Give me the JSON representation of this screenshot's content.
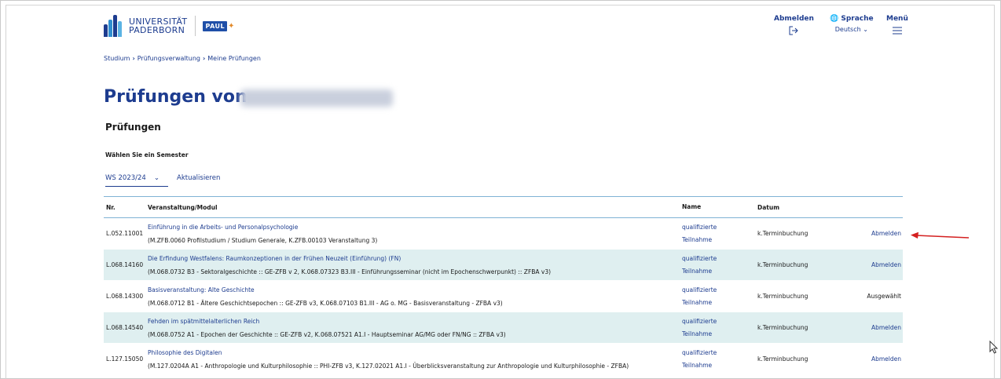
{
  "header": {
    "university_line1": "UNIVERSITÄT",
    "university_line2": "PADERBORN",
    "app_logo": "PAUL",
    "logout_label": "Abmelden",
    "language_label": "Sprache",
    "language_value": "Deutsch",
    "menu_label": "Menü"
  },
  "breadcrumb": [
    "Studium",
    "Prüfungsverwaltung",
    "Meine Prüfungen"
  ],
  "page": {
    "title": "Prüfungen von",
    "section_title": "Prüfungen",
    "semester_label": "Wählen Sie ein Semester",
    "semester_value": "WS 2023/24",
    "refresh_label": "Aktualisieren"
  },
  "table": {
    "headers": {
      "nr": "Nr.",
      "module": "Veranstaltung/Modul",
      "name": "Name",
      "date": "Datum"
    },
    "rows": [
      {
        "nr": "L.052.11001",
        "title": "Einführung in die Arbeits- und Personalpsychologie",
        "sub": "(M.ZFB.0060 Profilstudium / Studium Generale, K.ZFB.00103 Veranstaltung 3)",
        "name1": "qualifizierte",
        "name2": "Teilnahme",
        "date": "k.Terminbuchung",
        "action": "Abmelden"
      },
      {
        "nr": "L.068.14160",
        "title": "Die Erfindung Westfalens: Raumkonzeptionen in der Frühen Neuzeit (Einführung) (FN)",
        "sub": "(M.068.0732 B3 - Sektoralgeschichte :: GE-ZFB v 2, K.068.07323 B3.III - Einführungsseminar (nicht im Epochenschwerpunkt) :: ZFBA v3)",
        "name1": "qualifizierte",
        "name2": "Teilnahme",
        "date": "k.Terminbuchung",
        "action": "Abmelden"
      },
      {
        "nr": "L.068.14300",
        "title": "Basisveranstaltung: Alte Geschichte",
        "sub": "(M.068.0712 B1 - Ältere Geschichtsepochen :: GE-ZFB v3, K.068.07103 B1.III - AG o. MG - Basisveranstaltung - ZFBA v3)",
        "name1": "qualifizierte",
        "name2": "Teilnahme",
        "date": "k.Terminbuchung",
        "action": "Ausgewählt"
      },
      {
        "nr": "L.068.14540",
        "title": "Fehden im spätmittelalterlichen Reich",
        "sub": "(M.068.0752 A1 - Epochen der Geschichte :: GE-ZFB v2, K.068.07521 A1.I - Hauptseminar AG/MG oder FN/NG :: ZFBA v3)",
        "name1": "qualifizierte",
        "name2": "Teilnahme",
        "date": "k.Terminbuchung",
        "action": "Abmelden"
      },
      {
        "nr": "L.127.15050",
        "title": "Philosophie des Digitalen",
        "sub": "(M.127.0204A A1 - Anthropologie und Kulturphilosophie :: PHI-ZFB v3, K.127.02021 A1.I - Überblicksveranstaltung zur Anthropologie und Kulturphilosophie - ZFBA)",
        "name1": "qualifizierte",
        "name2": "Teilnahme",
        "date": "k.Terminbuchung",
        "action": "Abmelden"
      }
    ]
  },
  "colors": {
    "brand": "#1d3c8f",
    "row_alt": "#dfeff0",
    "table_line": "#7fb3d5",
    "annotation_arrow": "#d42020"
  }
}
